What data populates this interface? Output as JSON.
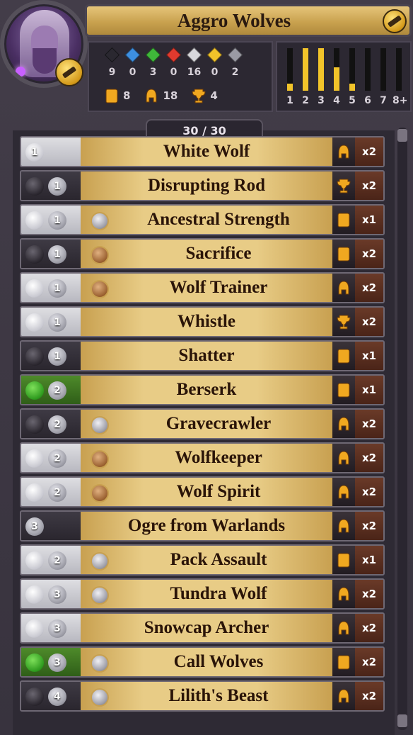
{
  "deck": {
    "title": "Aggro Wolves",
    "count": "30 / 30"
  },
  "mana": [
    {
      "color": "#2a2830",
      "value": "9"
    },
    {
      "color": "#3d8fe0",
      "value": "0"
    },
    {
      "color": "#3fb83a",
      "value": "3"
    },
    {
      "color": "#e03a2e",
      "value": "0"
    },
    {
      "color": "#d8d8dc",
      "value": "16"
    },
    {
      "color": "#f2c42a",
      "value": "0"
    },
    {
      "color": "#9a9aa4",
      "value": "2"
    }
  ],
  "types": [
    {
      "icon": "scroll-icon",
      "value": "8"
    },
    {
      "icon": "helmet-icon",
      "value": "18"
    },
    {
      "icon": "trophy-icon",
      "value": "4"
    }
  ],
  "curve": {
    "labels": [
      "1",
      "2",
      "3",
      "4",
      "5",
      "6",
      "7",
      "8+"
    ],
    "fill": [
      0.17,
      1.0,
      1.0,
      0.55,
      0.17,
      0,
      0,
      0
    ]
  },
  "cards": [
    {
      "name": "White Wolf",
      "cost": "1",
      "bg": "light",
      "gems": [
        "white"
      ],
      "medal": null,
      "type": "helmet",
      "qty": "x2"
    },
    {
      "name": "Disrupting Rod",
      "cost": "1",
      "bg": "dark",
      "gems": [
        "black",
        "grey"
      ],
      "medal": null,
      "type": "trophy",
      "qty": "x2"
    },
    {
      "name": "Ancestral Strength",
      "cost": "1",
      "bg": "light",
      "gems": [
        "white",
        "grey"
      ],
      "medal": "silver",
      "type": "scroll",
      "qty": "x1"
    },
    {
      "name": "Sacrifice",
      "cost": "1",
      "bg": "dark",
      "gems": [
        "black",
        "grey"
      ],
      "medal": "bronze",
      "type": "scroll",
      "qty": "x2"
    },
    {
      "name": "Wolf Trainer",
      "cost": "1",
      "bg": "light",
      "gems": [
        "white",
        "grey"
      ],
      "medal": "bronze",
      "type": "helmet",
      "qty": "x2"
    },
    {
      "name": "Whistle",
      "cost": "1",
      "bg": "light",
      "gems": [
        "white",
        "grey"
      ],
      "medal": null,
      "type": "trophy",
      "qty": "x2"
    },
    {
      "name": "Shatter",
      "cost": "1",
      "bg": "dark",
      "gems": [
        "black",
        "grey"
      ],
      "medal": null,
      "type": "scroll",
      "qty": "x1"
    },
    {
      "name": "Berserk",
      "cost": "2",
      "bg": "green",
      "gems": [
        "greengem",
        "grey"
      ],
      "medal": null,
      "type": "scroll",
      "qty": "x1"
    },
    {
      "name": "Gravecrawler",
      "cost": "2",
      "bg": "dark",
      "gems": [
        "black",
        "grey"
      ],
      "medal": "silver",
      "type": "helmet",
      "qty": "x2"
    },
    {
      "name": "Wolfkeeper",
      "cost": "2",
      "bg": "light",
      "gems": [
        "white",
        "grey"
      ],
      "medal": "bronze",
      "type": "helmet",
      "qty": "x2"
    },
    {
      "name": "Wolf Spirit",
      "cost": "2",
      "bg": "light",
      "gems": [
        "white",
        "grey"
      ],
      "medal": "bronze",
      "type": "helmet",
      "qty": "x2"
    },
    {
      "name": "Ogre from Warlands",
      "cost": "3",
      "bg": "dark",
      "gems": [
        "grey"
      ],
      "medal": null,
      "type": "helmet",
      "qty": "x2"
    },
    {
      "name": "Pack Assault",
      "cost": "2",
      "bg": "light",
      "gems": [
        "white",
        "grey"
      ],
      "medal": "silver",
      "type": "scroll",
      "qty": "x1"
    },
    {
      "name": "Tundra Wolf",
      "cost": "3",
      "bg": "light",
      "gems": [
        "white",
        "grey"
      ],
      "medal": "silver",
      "type": "helmet",
      "qty": "x2"
    },
    {
      "name": "Snowcap Archer",
      "cost": "3",
      "bg": "light",
      "gems": [
        "white",
        "grey"
      ],
      "medal": null,
      "type": "helmet",
      "qty": "x2"
    },
    {
      "name": "Call Wolves",
      "cost": "3",
      "bg": "green",
      "gems": [
        "greengem",
        "grey"
      ],
      "medal": "silver",
      "type": "scroll",
      "qty": "x2"
    },
    {
      "name": "Lilith's Beast",
      "cost": "4",
      "bg": "dark",
      "gems": [
        "black",
        "grey"
      ],
      "medal": "silver",
      "type": "helmet",
      "qty": "x2"
    }
  ]
}
